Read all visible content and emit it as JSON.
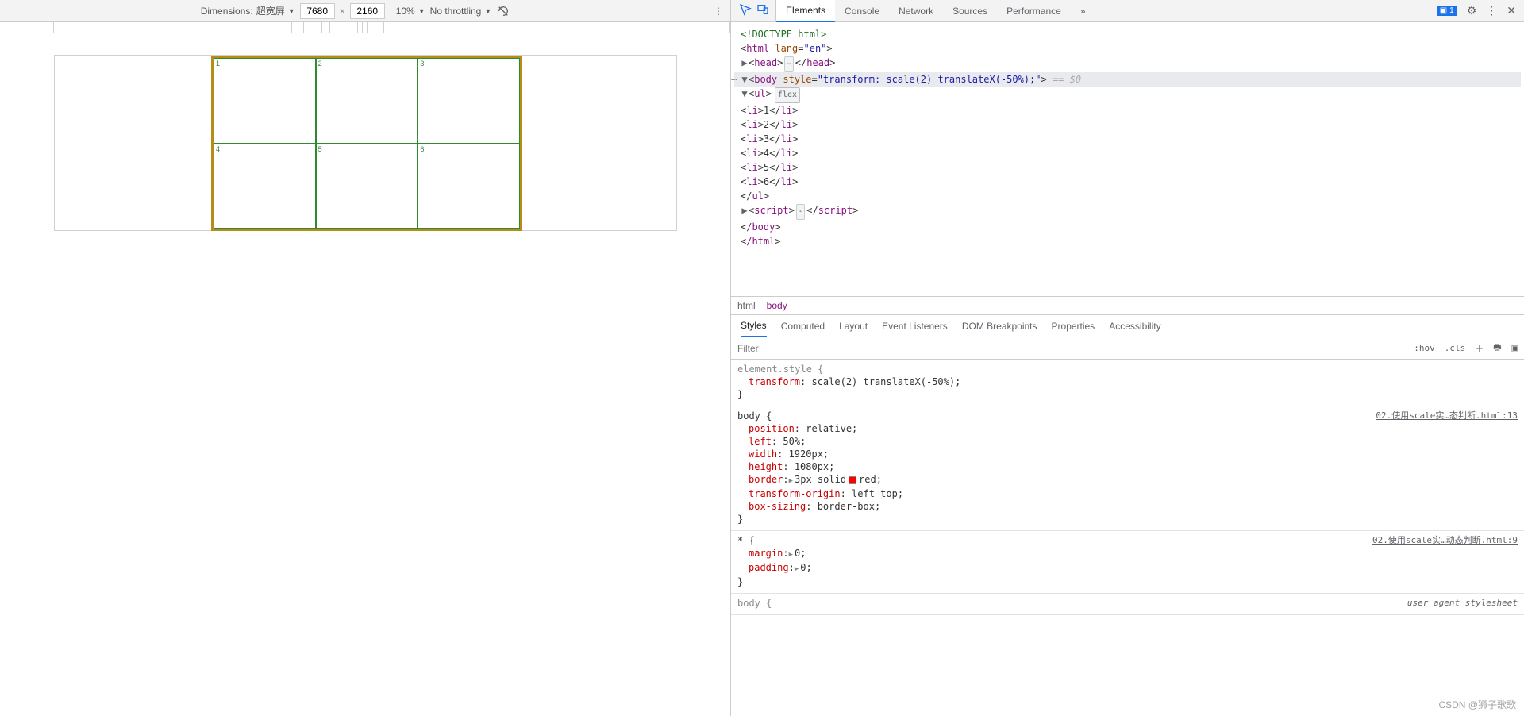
{
  "device_toolbar": {
    "dimensions_label": "Dimensions:",
    "device_name": "超宽屏",
    "width": "7680",
    "height": "2160",
    "zoom": "10%",
    "throttle": "No throttling"
  },
  "devtools_tabs": {
    "elements": "Elements",
    "console": "Console",
    "network": "Network",
    "sources": "Sources",
    "performance": "Performance",
    "issues_count": "1"
  },
  "dom": {
    "doctype": "<!DOCTYPE html>",
    "html_open": "html",
    "html_lang_attr": "lang",
    "html_lang_val": "\"en\"",
    "head": "head",
    "body_tag": "body",
    "body_style_attr": "style",
    "body_style_val": "\"transform: scale(2) translateX(-50%);\"",
    "eq_sel": "== $0",
    "ul": "ul",
    "flex_badge": "flex",
    "li": "li",
    "li_vals": [
      "1",
      "2",
      "3",
      "4",
      "5",
      "6"
    ],
    "script": "script",
    "close_body": "/body",
    "close_html": "/html"
  },
  "crumbs": {
    "html": "html",
    "body": "body"
  },
  "styles_tabs": {
    "styles": "Styles",
    "computed": "Computed",
    "layout": "Layout",
    "event_listeners": "Event Listeners",
    "dom_breakpoints": "DOM Breakpoints",
    "properties": "Properties",
    "accessibility": "Accessibility"
  },
  "filter": {
    "placeholder": "Filter",
    "hov": ":hov",
    "cls": ".cls"
  },
  "rules": {
    "elstyle_selector": "element.style {",
    "elstyle_prop": "transform",
    "elstyle_val": "scale(2) translateX(-50%);",
    "body_selector": "body {",
    "body_origin": "02.使用scale实…态判断.html:13",
    "body_props": [
      {
        "p": "position",
        "v": "relative;"
      },
      {
        "p": "left",
        "v": "50%;"
      },
      {
        "p": "width",
        "v": "1920px;"
      },
      {
        "p": "height",
        "v": "1080px;"
      },
      {
        "p": "border",
        "v": "3px solid",
        "swatch": true,
        "v2": "red;",
        "tri": true
      },
      {
        "p": "transform-origin",
        "v": "left top;"
      },
      {
        "p": "box-sizing",
        "v": "border-box;"
      }
    ],
    "star_selector": "* {",
    "star_origin": "02.使用scale实…动态判断.html:9",
    "star_props": [
      {
        "p": "margin",
        "v": "0;",
        "tri": true
      },
      {
        "p": "padding",
        "v": "0;",
        "tri": true
      }
    ],
    "ua_selector": "body {",
    "ua_origin": "user agent stylesheet"
  },
  "grid_cells": [
    "1",
    "2",
    "3",
    "4",
    "5",
    "6"
  ],
  "watermark": "CSDN @狮子歌歌"
}
